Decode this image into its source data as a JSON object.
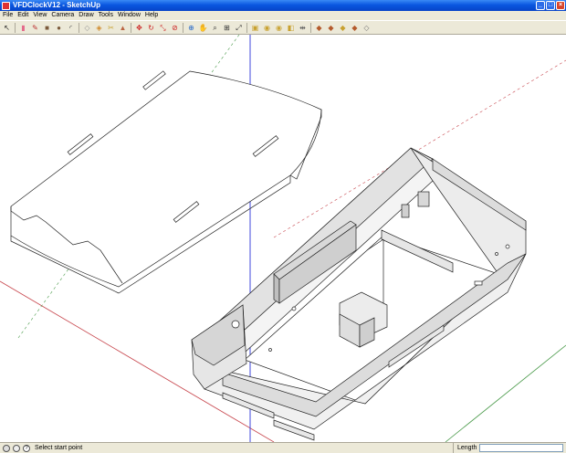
{
  "window": {
    "title": "VFDClockV12 - SketchUp"
  },
  "menu": [
    "File",
    "Edit",
    "View",
    "Camera",
    "Draw",
    "Tools",
    "Window",
    "Help"
  ],
  "toolbar": [
    {
      "icon": "select-arrow-icon",
      "glyph": "↖",
      "color": "#222"
    },
    {
      "icon": "sep"
    },
    {
      "icon": "eraser-icon",
      "glyph": "▮",
      "color": "#e46a8a"
    },
    {
      "icon": "pencil-icon",
      "glyph": "✎",
      "color": "#b33"
    },
    {
      "icon": "rectangle-icon",
      "glyph": "■",
      "color": "#7b5a3c"
    },
    {
      "icon": "circle-icon",
      "glyph": "●",
      "color": "#7b5a3c"
    },
    {
      "icon": "arc-icon",
      "glyph": "◜",
      "color": "#444"
    },
    {
      "icon": "sep"
    },
    {
      "icon": "make-component-icon",
      "glyph": "◇",
      "color": "#999"
    },
    {
      "icon": "paint-bucket-icon",
      "glyph": "◈",
      "color": "#d08a2a"
    },
    {
      "icon": "tape-measure-icon",
      "glyph": "✂",
      "color": "#c8a130"
    },
    {
      "icon": "push-pull-icon",
      "glyph": "▲",
      "color": "#b64"
    },
    {
      "icon": "sep"
    },
    {
      "icon": "move-icon",
      "glyph": "✥",
      "color": "#c22"
    },
    {
      "icon": "rotate-icon",
      "glyph": "↻",
      "color": "#c22"
    },
    {
      "icon": "scale-icon",
      "glyph": "⤡",
      "color": "#c22"
    },
    {
      "icon": "offset-icon",
      "glyph": "⊘",
      "color": "#c22"
    },
    {
      "icon": "sep"
    },
    {
      "icon": "orbit-icon",
      "glyph": "⊕",
      "color": "#2a6ac8"
    },
    {
      "icon": "pan-icon",
      "glyph": "✋",
      "color": "#c88"
    },
    {
      "icon": "zoom-icon",
      "glyph": "⌕",
      "color": "#333"
    },
    {
      "icon": "zoom-window-icon",
      "glyph": "⊞",
      "color": "#333"
    },
    {
      "icon": "zoom-extents-icon",
      "glyph": "⤢",
      "color": "#333"
    },
    {
      "icon": "sep"
    },
    {
      "icon": "camera-icon",
      "glyph": "▣",
      "color": "#c8a130"
    },
    {
      "icon": "walk-icon",
      "glyph": "◉",
      "color": "#c8a130"
    },
    {
      "icon": "look-around-icon",
      "glyph": "◉",
      "color": "#caa63a"
    },
    {
      "icon": "section-plane-icon",
      "glyph": "◧",
      "color": "#c8a130"
    },
    {
      "icon": "dimension-icon",
      "glyph": "⇹",
      "color": "#555"
    },
    {
      "icon": "sep"
    },
    {
      "icon": "components-icon",
      "glyph": "◆",
      "color": "#b45a2c"
    },
    {
      "icon": "materials-icon",
      "glyph": "◆",
      "color": "#b45a2c"
    },
    {
      "icon": "styles-icon",
      "glyph": "◆",
      "color": "#c8a130"
    },
    {
      "icon": "layers-icon",
      "glyph": "◆",
      "color": "#b45a2c"
    },
    {
      "icon": "outliner-icon",
      "glyph": "◇",
      "color": "#777"
    }
  ],
  "status": {
    "text": "Select start point",
    "measurement_label": "Length",
    "measurement_value": ""
  },
  "colors": {
    "red_axis": "#c8484f",
    "green_axis": "#4a9a4a",
    "blue_axis": "#2b36d9"
  }
}
